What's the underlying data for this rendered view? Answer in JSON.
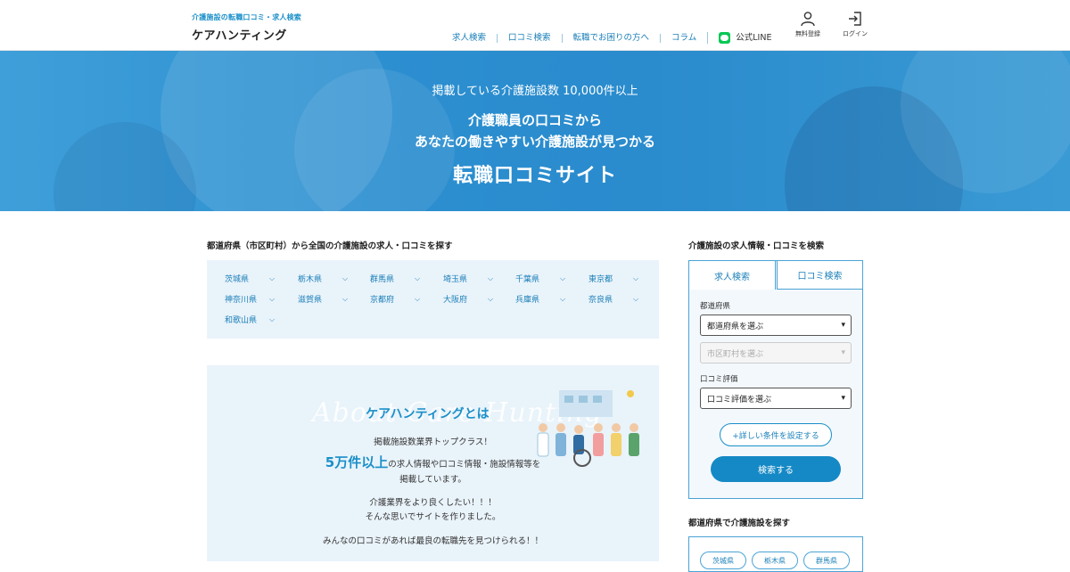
{
  "header": {
    "tagline": "介護施設の転職口コミ・求人検索",
    "logo": "ケアハンティング",
    "nav": [
      "求人検索",
      "口コミ検索",
      "転職でお困りの方へ",
      "コラム",
      "公式LINE"
    ],
    "register_label": "無料登録",
    "login_label": "ログイン"
  },
  "hero": {
    "count_text": "掲載している介護施設数 10,000件以上",
    "line1": "介護職員の口コミから",
    "line2": "あなたの働きやすい介護施設が見つかる",
    "headline": "転職口コミサイト"
  },
  "prefectures": {
    "title": "都道府県（市区町村）から全国の介護施設の求人・口コミを探す",
    "items": [
      "茨城県",
      "栃木県",
      "群馬県",
      "埼玉県",
      "千葉県",
      "東京都",
      "神奈川県",
      "滋賀県",
      "京都府",
      "大阪府",
      "兵庫県",
      "奈良県",
      "和歌山県"
    ]
  },
  "about": {
    "script_text": "About Care Hunting",
    "title": "ケアハンティングとは",
    "p1": "掲載施設数業界トップクラス！",
    "p2_big": "5万件以上",
    "p2_rest": "の求人情報や口コミ情報・施設情報等を",
    "p3": "掲載しています。",
    "p4": "介護業界をより良くしたい！！！",
    "p5": "そんな思いでサイトを作りました。",
    "p6": "みんなの口コミがあれば最良の転職先を見つけられる！！"
  },
  "search": {
    "title": "介護施設の求人情報・口コミを検索",
    "tab_jobs": "求人検索",
    "tab_reviews": "口コミ検索",
    "pref_label": "都道府県",
    "pref_select": "都道府県を選ぶ",
    "city_select": "市区町村を選ぶ",
    "rating_label": "口コミ評価",
    "rating_select": "口コミ評価を選ぶ",
    "detail_button": "+詳しい条件を設定する",
    "search_button": "検索する"
  },
  "side_prefs": {
    "title": "都道府県で介護施設を探す",
    "chips": [
      "茨城県",
      "栃木県",
      "群馬県"
    ]
  },
  "colors": {
    "accent": "#1a8fc9",
    "hero": "#2c8fd0",
    "panel": "#e9f3fa",
    "line_green": "#06c755"
  }
}
